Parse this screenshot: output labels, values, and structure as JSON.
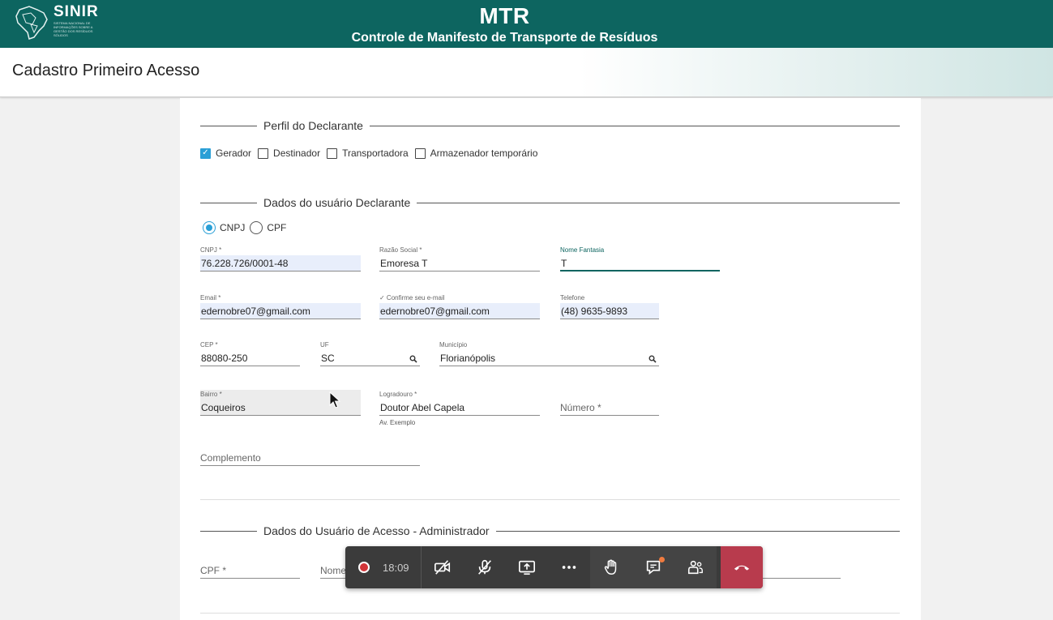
{
  "header": {
    "logo_title": "SINIR",
    "logo_sub": "SISTEMA NACIONAL DE INFORMAÇÕES SOBRE A GESTÃO DOS RESÍDUOS SÓLIDOS",
    "app_title": "MTR",
    "app_subtitle": "Controle de Manifesto de Transporte de Resíduos"
  },
  "page_title": "Cadastro Primeiro Acesso",
  "perfil": {
    "title": "Perfil do Declarante",
    "options": [
      {
        "label": "Gerador",
        "checked": true
      },
      {
        "label": "Destinador",
        "checked": false
      },
      {
        "label": "Transportadora",
        "checked": false
      },
      {
        "label": "Armazenador temporário",
        "checked": false
      }
    ]
  },
  "declarante": {
    "title": "Dados do usuário Declarante",
    "doc_types": [
      {
        "label": "CNPJ",
        "selected": true
      },
      {
        "label": "CPF",
        "selected": false
      }
    ],
    "cnpj": {
      "label": "CNPJ *",
      "value": "76.228.726/0001-48"
    },
    "razao": {
      "label": "Razão Social *",
      "value": "Emoresa T"
    },
    "fantasia": {
      "label": "Nome Fantasia",
      "value": "T"
    },
    "email": {
      "label": "Email *",
      "value": "edernobre07@gmail.com"
    },
    "confirm_email": {
      "label": "✓ Confirme seu e-mail",
      "value": "edernobre07@gmail.com"
    },
    "telefone": {
      "label": "Telefone",
      "value": "(48) 9635-9893"
    },
    "cep": {
      "label": "CEP *",
      "value": "88080-250"
    },
    "uf": {
      "label": "UF",
      "value": "SC"
    },
    "municipio": {
      "label": "Município",
      "value": "Florianópolis"
    },
    "bairro": {
      "label": "Bairro *",
      "value": "Coqueiros"
    },
    "logradouro": {
      "label": "Logradouro *",
      "value": "Doutor Abel Capela",
      "hint": "Av. Exemplo"
    },
    "numero": {
      "placeholder": "Número *"
    },
    "complemento": {
      "placeholder": "Complemento"
    }
  },
  "administrador": {
    "title": "Dados do Usuário de Acesso - Administrador",
    "cpf": {
      "placeholder": "CPF *"
    },
    "nome": {
      "placeholder": "Nome"
    }
  },
  "callbar": {
    "time": "18:09",
    "accent_hangup": "#b83b4d"
  }
}
